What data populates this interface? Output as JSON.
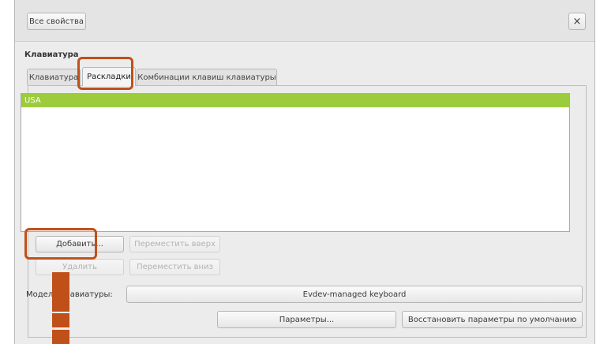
{
  "header": {
    "all_settings_label": "Все свойства",
    "close_glyph": "×"
  },
  "section_title": "Клавиатура",
  "tabs": [
    {
      "label": "Клавиатура",
      "active": false
    },
    {
      "label": "Раскладки",
      "active": true
    },
    {
      "label": "Комбинации клавиш клавиатуры",
      "active": false
    }
  ],
  "layouts": {
    "items": [
      "USA"
    ],
    "selected_color": "#9ccc3d"
  },
  "buttons": {
    "add": "Добавить...",
    "remove": "Удалить",
    "move_up": "Переместить вверх",
    "move_down": "Переместить вниз",
    "options": "Параметры...",
    "reset": "Восстановить параметры по умолчанию"
  },
  "model": {
    "label": "Модель клавиатуры:",
    "value": "Evdev-managed keyboard"
  },
  "annotation_color": "#c0501a"
}
